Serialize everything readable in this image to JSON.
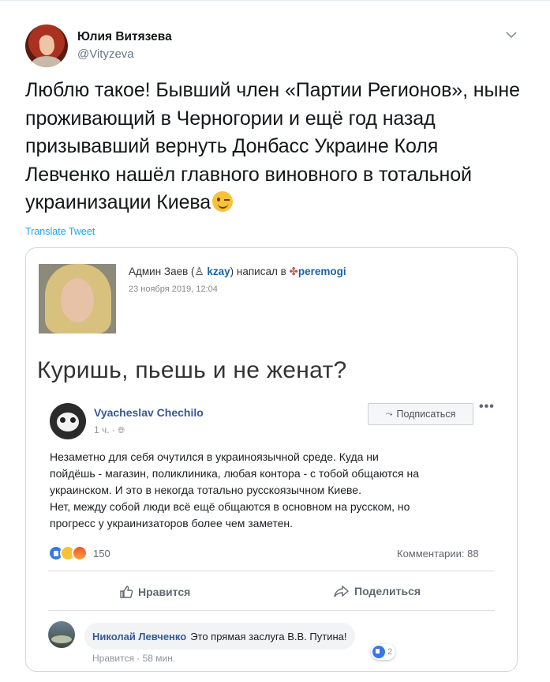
{
  "tweet": {
    "author_name": "Юлия Витязева",
    "author_handle": "@Vityzeva",
    "text": "Люблю такое! Бывший член «Партии Регионов», ныне проживающий в Черногории и ещё год назад призывавший вернуть Донбасс Украине Коля Левченко нашёл главного виновного в тотальной украинизации Киева",
    "emoji": "winking-face",
    "translate_label": "Translate Tweet"
  },
  "card": {
    "byline_prefix": "Админ Заев (",
    "byline_user": "kzay",
    "byline_mid": ") написал в ",
    "byline_community": "peremogi",
    "date": "23 ноября 2019, 12:04",
    "headline": "Куришь, пьешь и не женат?",
    "post": {
      "author": "Vyacheslav Chechilo",
      "time": "1 ч. ·",
      "subscribe_label": "Подписаться",
      "more_label": "•••",
      "lines": [
        "Незаметно для себя очутился в украиноязычной среде. Куда ни",
        "пойдёшь - магазин, поликлиника, любая контора - с тобой общаются на",
        "украинском. И это в некогда тотально русскоязычном Киеве.",
        "Нет, между собой люди всё ещё общаются в основном на русском, но",
        "прогресс у украинизаторов более чем заметен."
      ],
      "reactions_count": "150",
      "comments_label": "Комментарии: 88",
      "like_label": "Нравится",
      "share_label": "Поделиться"
    },
    "comment": {
      "author": "Николай Левченко",
      "text": "Это прямая заслуга В.В. Путина!",
      "reaction_count": "2",
      "actions": "Нравится · 58 мин."
    }
  },
  "colors": {
    "twitter_blue": "#1da1f2",
    "fb_link": "#385898",
    "lj_link": "#1a62a8"
  }
}
